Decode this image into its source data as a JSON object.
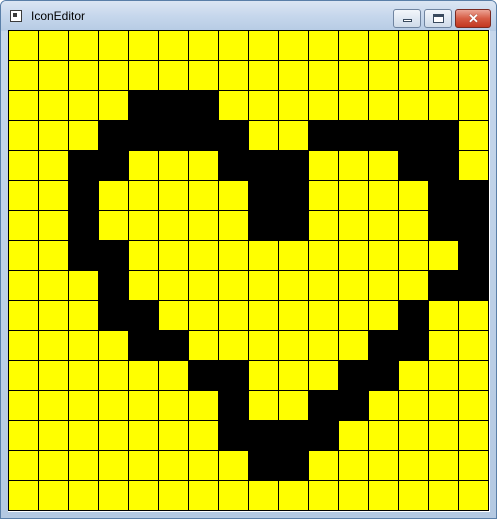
{
  "window": {
    "title": "IconEditor",
    "controls": {
      "minimize": "–",
      "maximize": "□",
      "close": "✕"
    }
  },
  "colors": {
    "background_pixel": "#ffff00",
    "foreground_pixel": "#000000",
    "grid_line": "#000000"
  },
  "icon": {
    "columns": 16,
    "rows": 16,
    "pixels": [
      "................",
      "................",
      "....###.........",
      "...#####..#####.",
      "..##...###...##.",
      "..#.....##....##",
      "..#.....##....##",
      "..##...........#",
      "...#..........##",
      "...##........#..",
      "....##......##..",
      "......##...##...",
      ".......#..##....",
      ".......####.....",
      "........##......",
      "................"
    ]
  }
}
